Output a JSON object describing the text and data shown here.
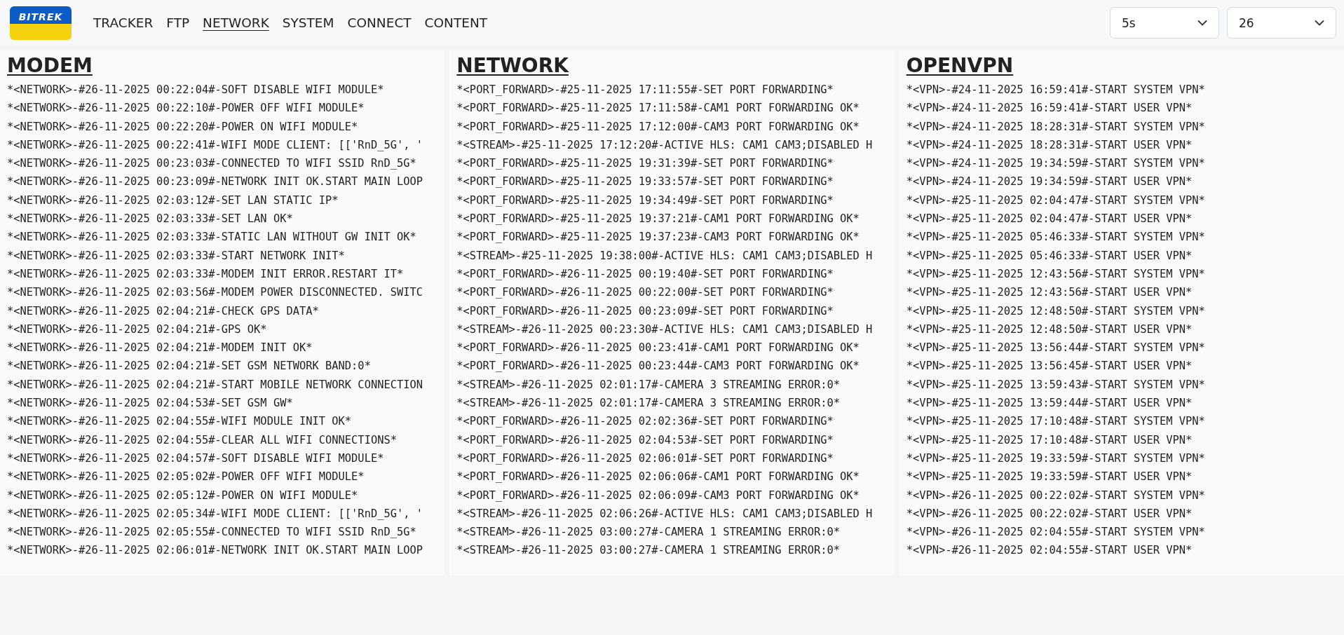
{
  "logo": {
    "text": "BITREK"
  },
  "nav": [
    {
      "label": "TRACKER",
      "selected": false
    },
    {
      "label": "FTP",
      "selected": false
    },
    {
      "label": "NETWORK",
      "selected": true
    },
    {
      "label": "SYSTEM",
      "selected": false
    },
    {
      "label": "CONNECT",
      "selected": false
    },
    {
      "label": "CONTENT",
      "selected": false
    }
  ],
  "selects": [
    {
      "value": "5s"
    },
    {
      "value": "26"
    }
  ],
  "panels": [
    {
      "title": "MODEM",
      "lines": [
        "*<NETWORK>-#26-11-2025 00:22:04#-SOFT DISABLE WIFI MODULE*",
        "*<NETWORK>-#26-11-2025 00:22:10#-POWER OFF WIFI MODULE*",
        "*<NETWORK>-#26-11-2025 00:22:20#-POWER ON WIFI MODULE*",
        "*<NETWORK>-#26-11-2025 00:22:41#-WIFI MODE CLIENT: [['RnD_5G', '",
        "*<NETWORK>-#26-11-2025 00:23:03#-CONNECTED TO WIFI SSID RnD_5G*",
        "*<NETWORK>-#26-11-2025 00:23:09#-NETWORK INIT OK.START MAIN LOOP",
        "*<NETWORK>-#26-11-2025 02:03:12#-SET LAN STATIC IP*",
        "*<NETWORK>-#26-11-2025 02:03:33#-SET LAN OK*",
        "*<NETWORK>-#26-11-2025 02:03:33#-STATIC LAN WITHOUT GW INIT OK*",
        "*<NETWORK>-#26-11-2025 02:03:33#-START NETWORK INIT*",
        "*<NETWORK>-#26-11-2025 02:03:33#-MODEM INIT ERROR.RESTART IT*",
        "*<NETWORK>-#26-11-2025 02:03:56#-MODEM POWER DISCONNECTED. SWITC",
        "*<NETWORK>-#26-11-2025 02:04:21#-CHECK GPS DATA*",
        "*<NETWORK>-#26-11-2025 02:04:21#-GPS OK*",
        "*<NETWORK>-#26-11-2025 02:04:21#-MODEM INIT OK*",
        "*<NETWORK>-#26-11-2025 02:04:21#-SET GSM NETWORK BAND:0*",
        "*<NETWORK>-#26-11-2025 02:04:21#-START MOBILE NETWORK CONNECTION",
        "*<NETWORK>-#26-11-2025 02:04:53#-SET GSM GW*",
        "*<NETWORK>-#26-11-2025 02:04:55#-WIFI MODULE INIT OK*",
        "*<NETWORK>-#26-11-2025 02:04:55#-CLEAR ALL WIFI CONNECTIONS*",
        "*<NETWORK>-#26-11-2025 02:04:57#-SOFT DISABLE WIFI MODULE*",
        "*<NETWORK>-#26-11-2025 02:05:02#-POWER OFF WIFI MODULE*",
        "*<NETWORK>-#26-11-2025 02:05:12#-POWER ON WIFI MODULE*",
        "*<NETWORK>-#26-11-2025 02:05:34#-WIFI MODE CLIENT: [['RnD_5G', '",
        "*<NETWORK>-#26-11-2025 02:05:55#-CONNECTED TO WIFI SSID RnD_5G*",
        "*<NETWORK>-#26-11-2025 02:06:01#-NETWORK INIT OK.START MAIN LOOP"
      ]
    },
    {
      "title": "NETWORK",
      "lines": [
        "*<PORT_FORWARD>-#25-11-2025 17:11:55#-SET PORT FORWARDING*",
        "*<PORT_FORWARD>-#25-11-2025 17:11:58#-CAM1 PORT FORWARDING OK*",
        "*<PORT_FORWARD>-#25-11-2025 17:12:00#-CAM3 PORT FORWARDING OK*",
        "*<STREAM>-#25-11-2025 17:12:20#-ACTIVE HLS: CAM1 CAM3;DISABLED H",
        "*<PORT_FORWARD>-#25-11-2025 19:31:39#-SET PORT FORWARDING*",
        "*<PORT_FORWARD>-#25-11-2025 19:33:57#-SET PORT FORWARDING*",
        "*<PORT_FORWARD>-#25-11-2025 19:34:49#-SET PORT FORWARDING*",
        "*<PORT_FORWARD>-#25-11-2025 19:37:21#-CAM1 PORT FORWARDING OK*",
        "*<PORT_FORWARD>-#25-11-2025 19:37:23#-CAM3 PORT FORWARDING OK*",
        "*<STREAM>-#25-11-2025 19:38:00#-ACTIVE HLS: CAM1 CAM3;DISABLED H",
        "*<PORT_FORWARD>-#26-11-2025 00:19:40#-SET PORT FORWARDING*",
        "*<PORT_FORWARD>-#26-11-2025 00:22:00#-SET PORT FORWARDING*",
        "*<PORT_FORWARD>-#26-11-2025 00:23:09#-SET PORT FORWARDING*",
        "*<STREAM>-#26-11-2025 00:23:30#-ACTIVE HLS: CAM1 CAM3;DISABLED H",
        "*<PORT_FORWARD>-#26-11-2025 00:23:41#-CAM1 PORT FORWARDING OK*",
        "*<PORT_FORWARD>-#26-11-2025 00:23:44#-CAM3 PORT FORWARDING OK*",
        "*<STREAM>-#26-11-2025 02:01:17#-CAMERA 3 STREAMING ERROR:0*",
        "*<STREAM>-#26-11-2025 02:01:17#-CAMERA 3 STREAMING ERROR:0*",
        "*<PORT_FORWARD>-#26-11-2025 02:02:36#-SET PORT FORWARDING*",
        "*<PORT_FORWARD>-#26-11-2025 02:04:53#-SET PORT FORWARDING*",
        "*<PORT_FORWARD>-#26-11-2025 02:06:01#-SET PORT FORWARDING*",
        "*<PORT_FORWARD>-#26-11-2025 02:06:06#-CAM1 PORT FORWARDING OK*",
        "*<PORT_FORWARD>-#26-11-2025 02:06:09#-CAM3 PORT FORWARDING OK*",
        "*<STREAM>-#26-11-2025 02:06:26#-ACTIVE HLS: CAM1 CAM3;DISABLED H",
        "*<STREAM>-#26-11-2025 03:00:27#-CAMERA 1 STREAMING ERROR:0*",
        "*<STREAM>-#26-11-2025 03:00:27#-CAMERA 1 STREAMING ERROR:0*"
      ]
    },
    {
      "title": "OPENVPN",
      "lines": [
        "*<VPN>-#24-11-2025 16:59:41#-START SYSTEM VPN*",
        "*<VPN>-#24-11-2025 16:59:41#-START USER VPN*",
        "*<VPN>-#24-11-2025 18:28:31#-START SYSTEM VPN*",
        "*<VPN>-#24-11-2025 18:28:31#-START USER VPN*",
        "*<VPN>-#24-11-2025 19:34:59#-START SYSTEM VPN*",
        "*<VPN>-#24-11-2025 19:34:59#-START USER VPN*",
        "*<VPN>-#25-11-2025 02:04:47#-START SYSTEM VPN*",
        "*<VPN>-#25-11-2025 02:04:47#-START USER VPN*",
        "*<VPN>-#25-11-2025 05:46:33#-START SYSTEM VPN*",
        "*<VPN>-#25-11-2025 05:46:33#-START USER VPN*",
        "*<VPN>-#25-11-2025 12:43:56#-START SYSTEM VPN*",
        "*<VPN>-#25-11-2025 12:43:56#-START USER VPN*",
        "*<VPN>-#25-11-2025 12:48:50#-START SYSTEM VPN*",
        "*<VPN>-#25-11-2025 12:48:50#-START USER VPN*",
        "*<VPN>-#25-11-2025 13:56:44#-START SYSTEM VPN*",
        "*<VPN>-#25-11-2025 13:56:45#-START USER VPN*",
        "*<VPN>-#25-11-2025 13:59:43#-START SYSTEM VPN*",
        "*<VPN>-#25-11-2025 13:59:44#-START USER VPN*",
        "*<VPN>-#25-11-2025 17:10:48#-START SYSTEM VPN*",
        "*<VPN>-#25-11-2025 17:10:48#-START USER VPN*",
        "*<VPN>-#25-11-2025 19:33:59#-START SYSTEM VPN*",
        "*<VPN>-#25-11-2025 19:33:59#-START USER VPN*",
        "*<VPN>-#26-11-2025 00:22:02#-START SYSTEM VPN*",
        "*<VPN>-#26-11-2025 00:22:02#-START USER VPN*",
        "*<VPN>-#26-11-2025 02:04:55#-START SYSTEM VPN*",
        "*<VPN>-#26-11-2025 02:04:55#-START USER VPN*"
      ]
    }
  ]
}
